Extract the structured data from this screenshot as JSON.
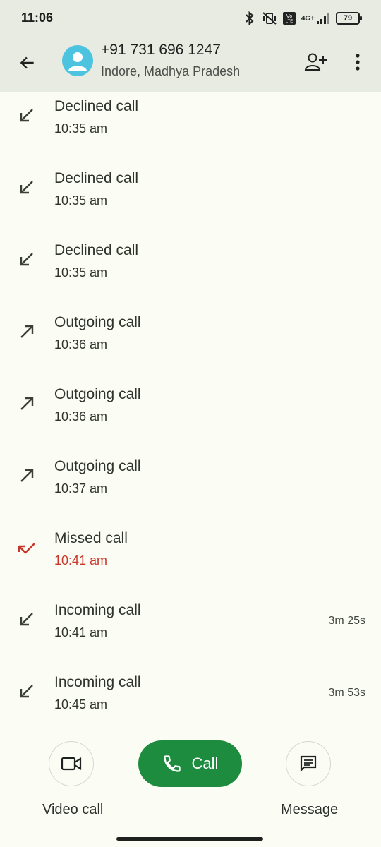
{
  "status": {
    "time": "11:06",
    "network": "4G+",
    "battery": "79"
  },
  "header": {
    "number": "+91 731 696 1247",
    "location": "Indore, Madhya Pradesh"
  },
  "calls": [
    {
      "type": "Declined call",
      "time": "10:35 am",
      "duration": "",
      "direction": "incoming"
    },
    {
      "type": "Declined call",
      "time": "10:35 am",
      "duration": "",
      "direction": "incoming"
    },
    {
      "type": "Declined call",
      "time": "10:35 am",
      "duration": "",
      "direction": "incoming"
    },
    {
      "type": "Outgoing call",
      "time": "10:36 am",
      "duration": "",
      "direction": "outgoing"
    },
    {
      "type": "Outgoing call",
      "time": "10:36 am",
      "duration": "",
      "direction": "outgoing"
    },
    {
      "type": "Outgoing call",
      "time": "10:37 am",
      "duration": "",
      "direction": "outgoing"
    },
    {
      "type": "Missed call",
      "time": "10:41 am",
      "duration": "",
      "direction": "missed"
    },
    {
      "type": "Incoming call",
      "time": "10:41 am",
      "duration": "3m 25s",
      "direction": "incoming"
    },
    {
      "type": "Incoming call",
      "time": "10:45 am",
      "duration": "3m 53s",
      "direction": "incoming"
    }
  ],
  "actions": {
    "call": "Call",
    "video_call": "Video call",
    "message": "Message"
  },
  "colors": {
    "accent_green": "#1e8c3e",
    "missed_red": "#c8372b",
    "avatar": "#4cc3df"
  }
}
